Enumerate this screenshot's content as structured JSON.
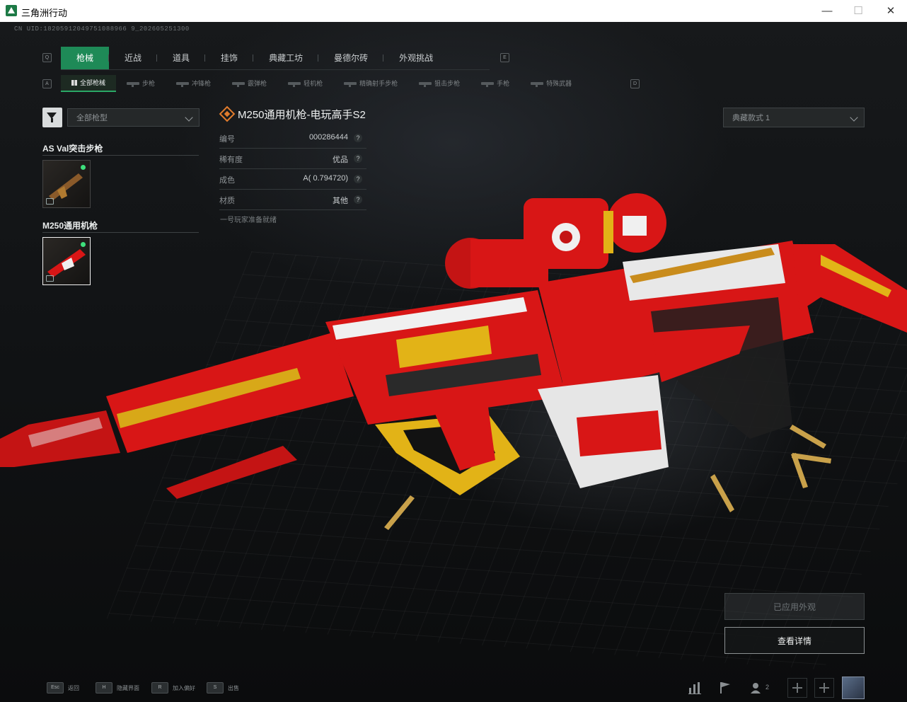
{
  "window": {
    "title": "三角洲行动",
    "minimize": "—",
    "maximize": "☐",
    "close": "✕"
  },
  "uid": "CN UID:18205912049751088966 9_202605251300",
  "tab_keys": {
    "left": "Q",
    "right": "E"
  },
  "tabs": [
    {
      "label": "枪械",
      "active": true
    },
    {
      "label": "近战",
      "active": false
    },
    {
      "label": "道具",
      "active": false
    },
    {
      "label": "挂饰",
      "active": false
    },
    {
      "label": "典藏工坊",
      "active": false
    },
    {
      "label": "曼德尔砖",
      "active": false
    },
    {
      "label": "外观挑战",
      "active": false
    }
  ],
  "subtab_keys": {
    "left": "A",
    "right": "D"
  },
  "subtabs": [
    {
      "label": "全部枪械",
      "active": true
    },
    {
      "label": "步枪",
      "active": false
    },
    {
      "label": "冲锋枪",
      "active": false
    },
    {
      "label": "霰弹枪",
      "active": false
    },
    {
      "label": "轻机枪",
      "active": false
    },
    {
      "label": "精确射手步枪",
      "active": false
    },
    {
      "label": "狙击步枪",
      "active": false
    },
    {
      "label": "手枪",
      "active": false
    },
    {
      "label": "特殊武器",
      "active": false
    }
  ],
  "filter": {
    "selected": "全部枪型"
  },
  "groups": [
    {
      "title": "AS Val突击步枪"
    },
    {
      "title": "M250通用机枪"
    }
  ],
  "item": {
    "title": "M250通用机枪-电玩高手S2",
    "rows": [
      {
        "key": "编号",
        "value": "000286444"
      },
      {
        "key": "稀有度",
        "value": "优品"
      },
      {
        "key": "成色",
        "value": "A( 0.794720)"
      },
      {
        "key": "材质",
        "value": "其他"
      }
    ],
    "note": "一号玩家准备就绪",
    "help": "?"
  },
  "style_select": {
    "selected": "典藏款式 1"
  },
  "buttons": {
    "applied": "已应用外观",
    "details": "查看详情"
  },
  "hints": [
    {
      "key": "Esc",
      "label": "返回"
    },
    {
      "key": "H",
      "label": "隐藏界面"
    },
    {
      "key": "R",
      "label": "加入偏好"
    },
    {
      "key": "S",
      "label": "出售"
    }
  ],
  "toolbar": {
    "friends_count": "2"
  },
  "colors": {
    "accent": "#1e8a57",
    "online": "#3ee07c",
    "weapon_red": "#d81616",
    "weapon_gold": "#d8a818",
    "rarity_icon": "#e07b2c"
  },
  "icons": [
    "filter-icon",
    "chevron-down-icon",
    "question-icon",
    "bar-chart-icon",
    "flag-icon",
    "friends-icon",
    "plus-icon",
    "avatar"
  ]
}
